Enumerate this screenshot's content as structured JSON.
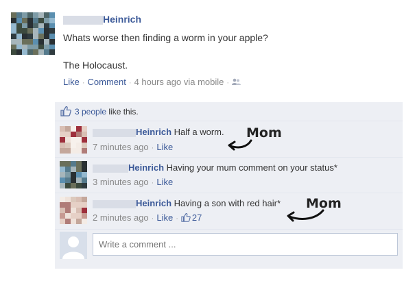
{
  "post": {
    "poster_name": "Heinrich",
    "text_line1": "Whats worse then finding a worm in your apple?",
    "text_line2": "The Holocaust.",
    "actions": {
      "like": "Like",
      "comment": "Comment",
      "time": "4 hours ago via mobile"
    }
  },
  "likes": {
    "count_text": "3 people",
    "suffix": " like this."
  },
  "comments": [
    {
      "name": "Heinrich",
      "text": "Half a worm.",
      "time": "7 minutes ago",
      "like": "Like",
      "annotation": "Mom"
    },
    {
      "name": "Heinrich",
      "text": "Having your mum comment on your status*",
      "time": "3 minutes ago",
      "like": "Like"
    },
    {
      "name": "Heinrich",
      "text": "Having a son with red hair*",
      "time": "2 minutes ago",
      "like": "Like",
      "like_count": "27",
      "annotation": "Mom"
    }
  ],
  "composer": {
    "placeholder": "Write a comment ..."
  },
  "colors": {
    "link": "#3b5998",
    "meta": "#888888",
    "ufi_background": "#edeff4"
  },
  "icons": {
    "like": "thumbs-up-icon",
    "audience": "friends-icon",
    "annotation_arrow": "curved-arrow-icon"
  }
}
